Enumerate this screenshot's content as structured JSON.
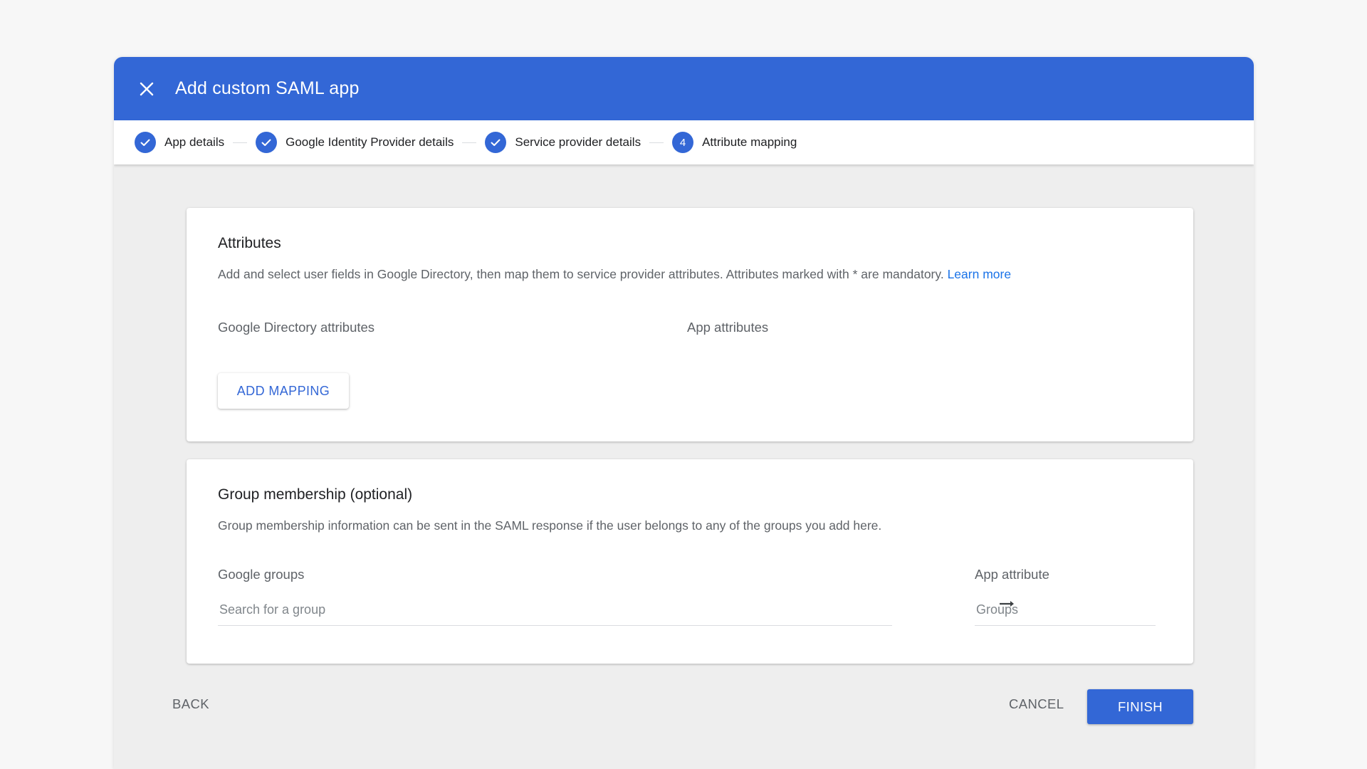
{
  "dialog": {
    "title": "Add custom SAML app",
    "close_icon": "close-icon"
  },
  "stepper": {
    "steps": [
      {
        "label": "App details",
        "status": "done",
        "icon": "check-icon"
      },
      {
        "label": "Google Identity Provider details",
        "status": "done",
        "icon": "check-icon"
      },
      {
        "label": "Service provider details",
        "status": "done",
        "icon": "check-icon"
      },
      {
        "label": "Attribute mapping",
        "status": "current",
        "number": "4"
      }
    ]
  },
  "attributes": {
    "title": "Attributes",
    "description": "Add and select user fields in Google Directory, then map them to service provider attributes. Attributes marked with * are mandatory.",
    "learn_more": "Learn more",
    "col_directory": "Google Directory attributes",
    "col_app": "App attributes",
    "add_mapping": "ADD MAPPING"
  },
  "groups": {
    "title": "Group membership (optional)",
    "description": "Group membership information can be sent in the SAML response if the user belongs to any of the groups you add here.",
    "col_google_groups": "Google groups",
    "col_app_attribute": "App attribute",
    "search_placeholder": "Search for a group",
    "app_attribute_placeholder": "Groups",
    "arrow_icon": "arrow-right-icon"
  },
  "footer": {
    "back": "BACK",
    "cancel": "CANCEL",
    "finish": "FINISH"
  },
  "colors": {
    "primary": "#3367d6",
    "link": "#1a73e8"
  }
}
